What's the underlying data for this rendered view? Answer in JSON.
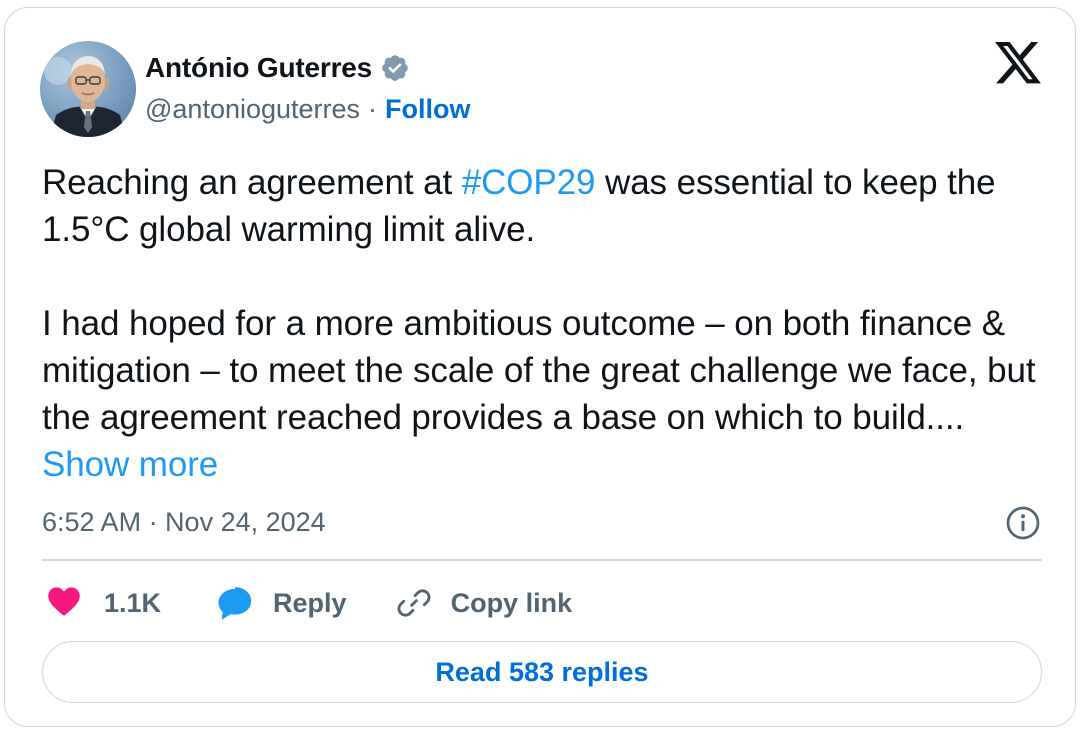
{
  "author": {
    "name": "António Guterres",
    "handle": "@antonioguterres",
    "separator": "·",
    "follow_label": "Follow",
    "verified_icon": "verified-badge-icon"
  },
  "tweet": {
    "line1_before": "Reaching an agreement at ",
    "hashtag": "#COP29",
    "line1_after": " was essential to keep the 1.5°C global warming limit alive.",
    "paragraph2": "I had hoped for a more ambitious outcome – on both finance & mitigation – to meet the scale of the great challenge we face, but the agreement reached provides a base on which to build....",
    "show_more": "Show more",
    "timestamp": "6:52 AM · Nov 24, 2024"
  },
  "actions": {
    "likes": "1.1K",
    "reply_label": "Reply",
    "copy_link_label": "Copy link",
    "read_replies_label": "Read 583 replies"
  },
  "icons": {
    "brand": "x-logo-icon",
    "info": "info-icon",
    "like": "heart-icon",
    "reply": "speech-bubble-icon",
    "copy": "link-icon"
  },
  "colors": {
    "link": "#1d9bf0",
    "follow": "#006fd6",
    "like": "#f91880",
    "muted": "#536471",
    "border": "#cfd9de"
  }
}
